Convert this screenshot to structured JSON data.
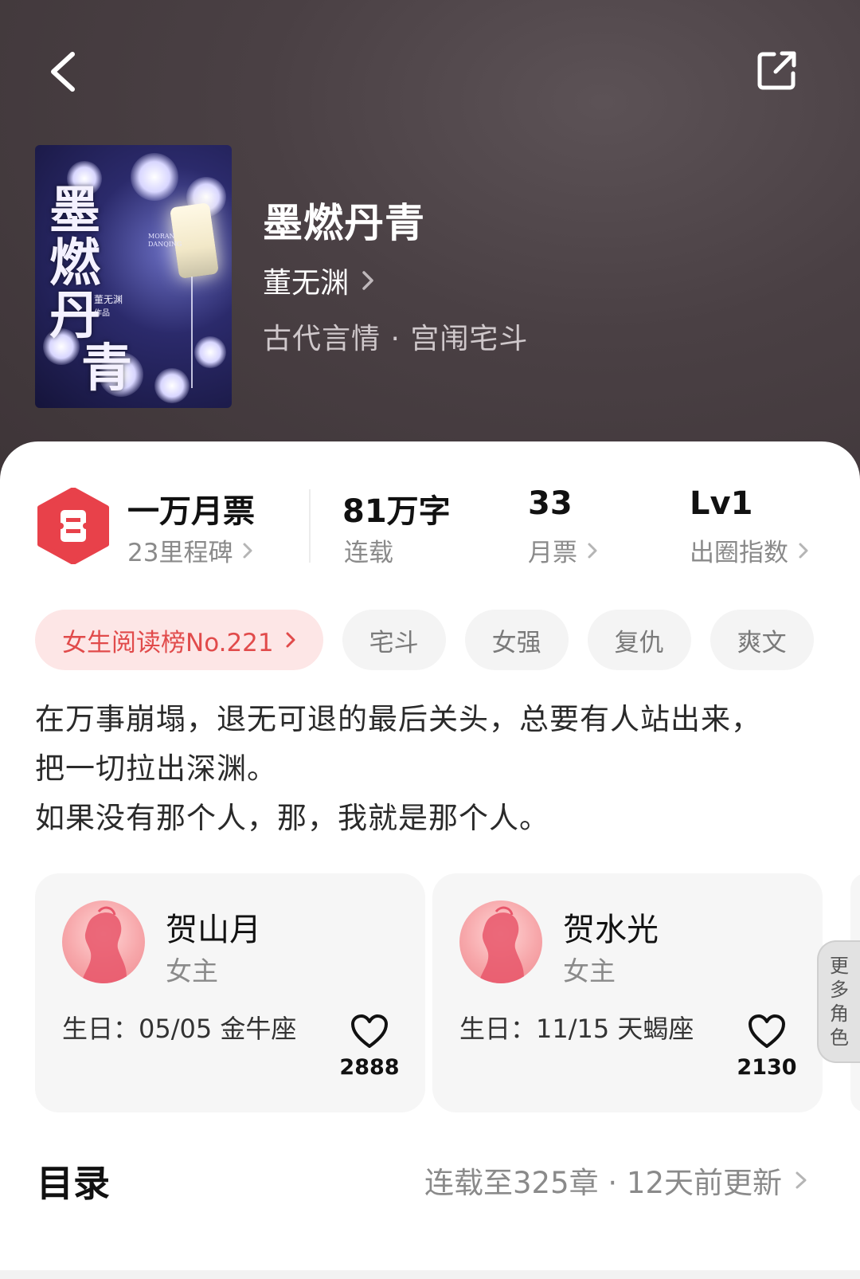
{
  "book": {
    "title": "墨燃丹青",
    "author": "董无渊",
    "genre": "古代言情 · 宫闱宅斗",
    "cover": {
      "title_line1": "墨",
      "title_line2": "燃丹",
      "title_line3": "青",
      "author_line": "董无渊",
      "works_label": "作品",
      "pinyin": "MORAN DANQING"
    }
  },
  "stats": {
    "milestone": {
      "main": "一万月票",
      "sub": "23里程碑"
    },
    "words": {
      "main": "81万字",
      "sub": "连载"
    },
    "tickets": {
      "main": "33",
      "sub": "月票"
    },
    "level": {
      "main": "Lv1",
      "sub": "出圈指数"
    }
  },
  "tags": {
    "rank": "女生阅读榜No.221",
    "items": [
      "宅斗",
      "女强",
      "复仇",
      "爽文"
    ]
  },
  "synopsis": {
    "line1": "在万事崩塌，退无可退的最后关头，总要有人站出来，",
    "line2": "把一切拉出深渊。",
    "line3": "如果没有那个人，那，我就是那个人。"
  },
  "roles": [
    {
      "name": "贺山月",
      "type": "女主",
      "birthday": "生日：05/05 金牛座",
      "likes": "2888"
    },
    {
      "name": "贺水光",
      "type": "女主",
      "birthday": "生日：11/15 天蝎座",
      "likes": "2130"
    }
  ],
  "more_roles": {
    "c1": "更",
    "c2": "多",
    "c3": "角",
    "c4": "色"
  },
  "toc": {
    "title": "目录",
    "info": "连载至325章 · 12天前更新"
  },
  "colors": {
    "header_bg": "#4a4044",
    "accent_red": "#e8414a",
    "rank_tag_bg": "#fde6e6",
    "rank_tag_text": "#e14b4b",
    "tag_bg": "#f4f4f4"
  },
  "icons": {
    "back": "chevron-left-icon",
    "share": "share-icon",
    "ticket": "ticket-badge-icon",
    "like": "heart-icon",
    "chevron": "chevron-right-icon"
  }
}
